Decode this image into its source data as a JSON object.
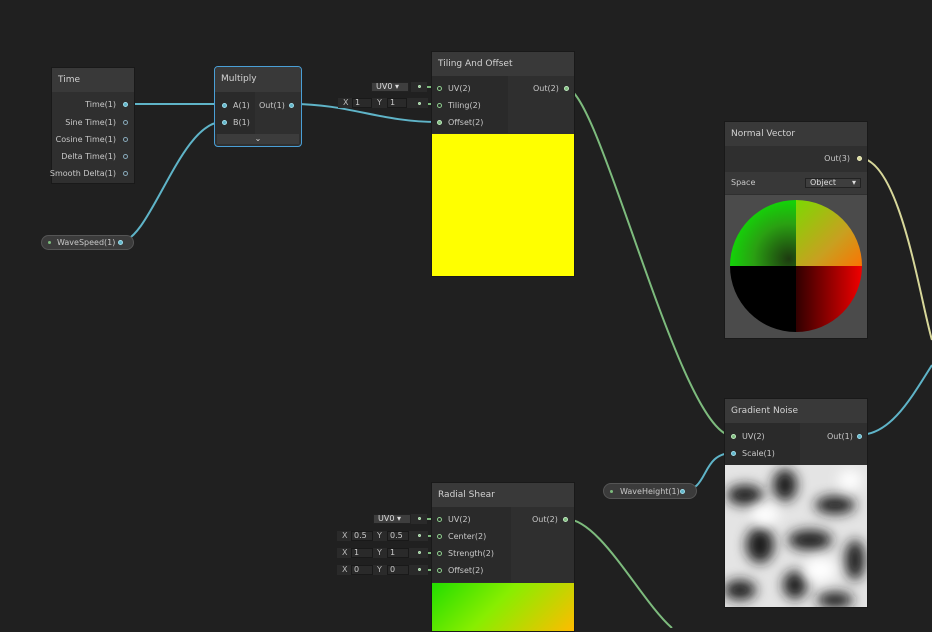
{
  "nodes": {
    "time": {
      "title": "Time",
      "outputs": [
        "Time(1)",
        "Sine Time(1)",
        "Cosine Time(1)",
        "Delta Time(1)",
        "Smooth Delta(1)"
      ]
    },
    "multiply": {
      "title": "Multiply",
      "input_a": "A(1)",
      "input_b": "B(1)",
      "output": "Out(1)"
    },
    "tiling_offset": {
      "title": "Tiling And Offset",
      "input_uv": "UV(2)",
      "input_tiling": "Tiling(2)",
      "input_offset": "Offset(2)",
      "output": "Out(2)",
      "uv_value": "UV0",
      "tiling_x_label": "X",
      "tiling_x": "1",
      "tiling_y_label": "Y",
      "tiling_y": "1",
      "preview_color": "#ffff00"
    },
    "normal_vector": {
      "title": "Normal Vector",
      "output": "Out(3)",
      "space_label": "Space",
      "space_value": "Object"
    },
    "gradient_noise": {
      "title": "Gradient Noise",
      "input_uv": "UV(2)",
      "input_scale": "Scale(1)",
      "output": "Out(1)"
    },
    "radial_shear": {
      "title": "Radial Shear",
      "input_uv": "UV(2)",
      "input_center": "Center(2)",
      "input_strength": "Strength(2)",
      "input_offset": "Offset(2)",
      "output": "Out(2)",
      "uv_value": "UV0",
      "x_label": "X",
      "y_label": "Y",
      "center_x": "0.5",
      "center_y": "0.5",
      "strength_x": "1",
      "strength_y": "1",
      "offset_x": "0",
      "offset_y": "0"
    }
  },
  "properties": {
    "wave_speed": "WaveSpeed(1)",
    "wave_height": "WaveHeight(1)"
  },
  "colors": {
    "canvas": "#202020",
    "float_wire": "#5fb4c8",
    "vector2_wire": "#7dbb7d",
    "vector3_wire": "#d7d79a",
    "selection": "#4a9fd6"
  }
}
